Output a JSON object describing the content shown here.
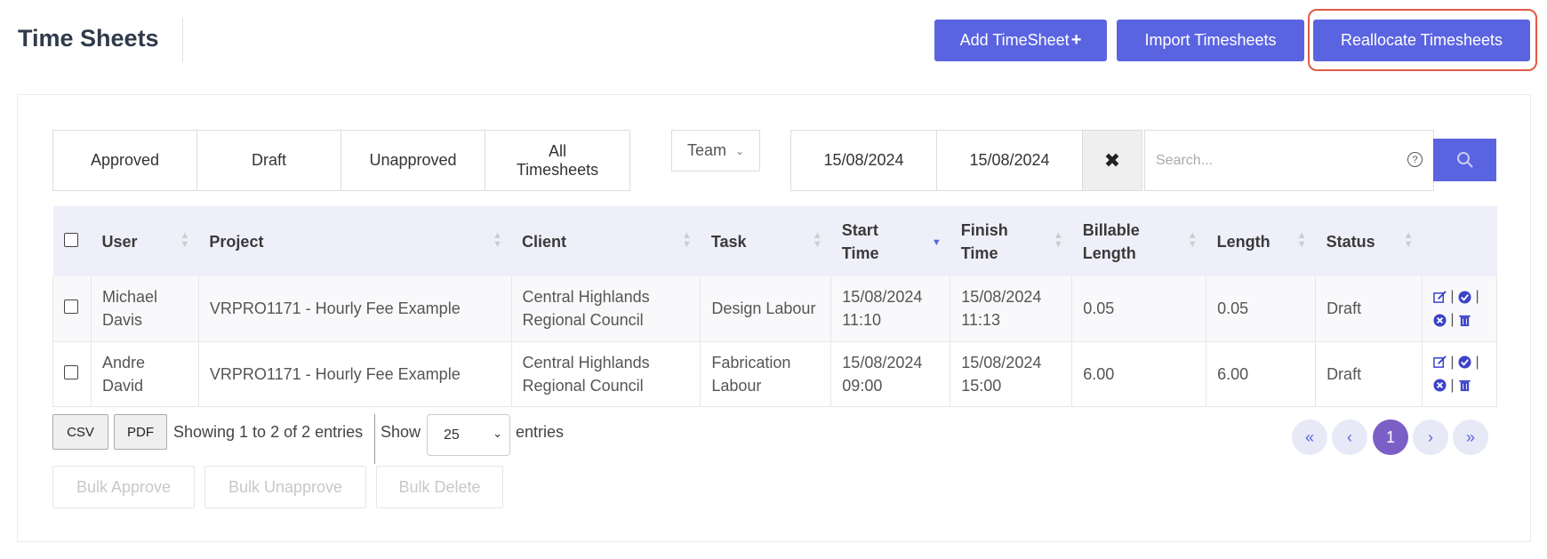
{
  "header": {
    "title": "Time Sheets",
    "add_label": "Add TimeSheet",
    "import_label": "Import Timesheets",
    "reallocate_label": "Reallocate Timesheets"
  },
  "filters": {
    "tabs": [
      "Approved",
      "Draft",
      "Unapproved",
      "All Timesheets"
    ],
    "team_label": "Team",
    "date_from": "15/08/2024",
    "date_to": "15/08/2024",
    "search_placeholder": "Search..."
  },
  "table": {
    "columns": [
      "User",
      "Project",
      "Client",
      "Task",
      "Start Time",
      "Finish Time",
      "Billable Length",
      "Length",
      "Status"
    ],
    "sorted_column": "Start Time",
    "rows": [
      {
        "user": "Michael Davis",
        "project": "VRPRO1171 - Hourly Fee Example",
        "client": "Central Highlands Regional Council",
        "task": "Design Labour",
        "start": "15/08/2024 11:10",
        "finish": "15/08/2024 11:13",
        "billable": "0.05",
        "length": "0.05",
        "status": "Draft"
      },
      {
        "user": "Andre David",
        "project": "VRPRO1171 - Hourly Fee Example",
        "client": "Central Highlands Regional Council",
        "task": "Fabrication Labour",
        "start": "15/08/2024 09:00",
        "finish": "15/08/2024 15:00",
        "billable": "6.00",
        "length": "6.00",
        "status": "Draft"
      }
    ]
  },
  "footer": {
    "csv_label": "CSV",
    "pdf_label": "PDF",
    "showing_text": "Showing 1 to 2 of 2 entries",
    "show_label": "Show",
    "page_size": "25",
    "entries_label": "entries",
    "current_page": "1",
    "bulk_approve": "Bulk Approve",
    "bulk_unapprove": "Bulk Unapprove",
    "bulk_delete": "Bulk Delete"
  },
  "colors": {
    "primary": "#5b64e0",
    "highlight": "#e05a44",
    "active_page": "#7b5ec6"
  }
}
